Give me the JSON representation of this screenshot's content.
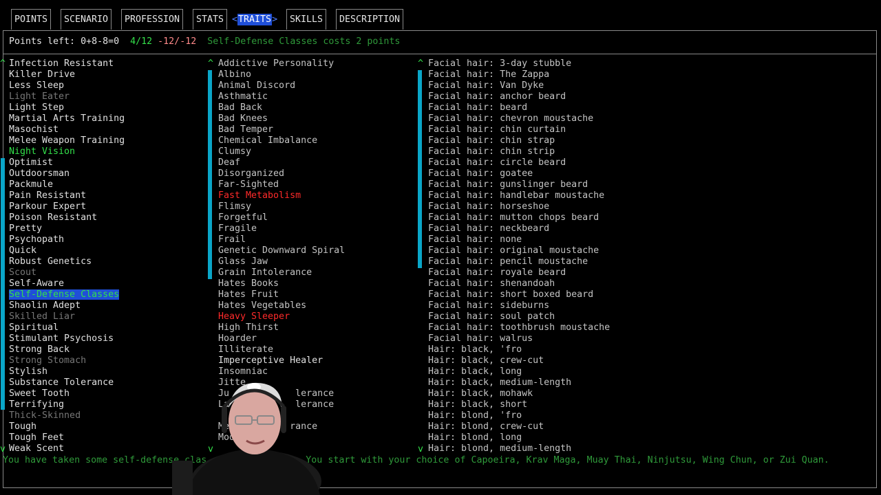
{
  "tabs": [
    {
      "label": "POINTS"
    },
    {
      "label": "SCENARIO"
    },
    {
      "label": "PROFESSION"
    },
    {
      "label": "STATS"
    },
    {
      "label": "TRAITS"
    },
    {
      "label": "SKILLS"
    },
    {
      "label": "DESCRIPTION"
    }
  ],
  "arrows": {
    "left": "<",
    "right": ">"
  },
  "status": {
    "points_left": "Points left: 0+8-8=0",
    "positive": "4/12",
    "negative": "-12/-12",
    "cost_msg": "Self-Defense Classes costs 2 points"
  },
  "scroll_glyphs": {
    "up": "^",
    "down": "v"
  },
  "col1": [
    {
      "t": "Infection Resistant",
      "s": "normal"
    },
    {
      "t": "Killer Drive",
      "s": "normal"
    },
    {
      "t": "Less Sleep",
      "s": "normal"
    },
    {
      "t": "Light Eater",
      "s": "dim"
    },
    {
      "t": "Light Step",
      "s": "normal"
    },
    {
      "t": "Martial Arts Training",
      "s": "normal"
    },
    {
      "t": "Masochist",
      "s": "normal"
    },
    {
      "t": "Melee Weapon Training",
      "s": "normal"
    },
    {
      "t": "Night Vision",
      "s": "green"
    },
    {
      "t": "Optimist",
      "s": "normal"
    },
    {
      "t": "Outdoorsman",
      "s": "normal"
    },
    {
      "t": "Packmule",
      "s": "normal"
    },
    {
      "t": "Pain Resistant",
      "s": "normal"
    },
    {
      "t": "Parkour Expert",
      "s": "normal"
    },
    {
      "t": "Poison Resistant",
      "s": "normal"
    },
    {
      "t": "Pretty",
      "s": "normal"
    },
    {
      "t": "Psychopath",
      "s": "normal"
    },
    {
      "t": "Quick",
      "s": "normal"
    },
    {
      "t": "Robust Genetics",
      "s": "normal"
    },
    {
      "t": "Scout",
      "s": "dim"
    },
    {
      "t": "Self-Aware",
      "s": "normal"
    },
    {
      "t": "Self-Defense Classes",
      "s": "sel"
    },
    {
      "t": "Shaolin Adept",
      "s": "normal"
    },
    {
      "t": "Skilled Liar",
      "s": "dim"
    },
    {
      "t": "Spiritual",
      "s": "normal"
    },
    {
      "t": "Stimulant Psychosis",
      "s": "normal"
    },
    {
      "t": "Strong Back",
      "s": "normal"
    },
    {
      "t": "Strong Stomach",
      "s": "dim"
    },
    {
      "t": "Stylish",
      "s": "normal"
    },
    {
      "t": "Substance Tolerance",
      "s": "normal"
    },
    {
      "t": "Sweet Tooth",
      "s": "normal"
    },
    {
      "t": "Terrifying",
      "s": "normal"
    },
    {
      "t": "Thick-Skinned",
      "s": "dim"
    },
    {
      "t": "Tough",
      "s": "normal"
    },
    {
      "t": "Tough Feet",
      "s": "normal"
    },
    {
      "t": "Weak Scent",
      "s": "normal"
    }
  ],
  "col2": [
    {
      "t": "Addictive Personality",
      "s": "gray"
    },
    {
      "t": "Albino",
      "s": "gray"
    },
    {
      "t": "Animal Discord",
      "s": "gray"
    },
    {
      "t": "Asthmatic",
      "s": "gray"
    },
    {
      "t": "Bad Back",
      "s": "gray"
    },
    {
      "t": "Bad Knees",
      "s": "gray"
    },
    {
      "t": "Bad Temper",
      "s": "gray"
    },
    {
      "t": "Chemical Imbalance",
      "s": "gray"
    },
    {
      "t": "Clumsy",
      "s": "gray"
    },
    {
      "t": "Deaf",
      "s": "gray"
    },
    {
      "t": "Disorganized",
      "s": "gray"
    },
    {
      "t": "Far-Sighted",
      "s": "gray"
    },
    {
      "t": "Fast Metabolism",
      "s": "red"
    },
    {
      "t": "Flimsy",
      "s": "gray"
    },
    {
      "t": "Forgetful",
      "s": "gray"
    },
    {
      "t": "Fragile",
      "s": "gray"
    },
    {
      "t": "Frail",
      "s": "gray"
    },
    {
      "t": "Genetic Downward Spiral",
      "s": "gray"
    },
    {
      "t": "Glass Jaw",
      "s": "gray"
    },
    {
      "t": "Grain Intolerance",
      "s": "gray"
    },
    {
      "t": "Hates Books",
      "s": "gray"
    },
    {
      "t": "Hates Fruit",
      "s": "gray"
    },
    {
      "t": "Hates Vegetables",
      "s": "gray"
    },
    {
      "t": "Heavy Sleeper",
      "s": "red"
    },
    {
      "t": "High Thirst",
      "s": "gray"
    },
    {
      "t": "Hoarder",
      "s": "gray"
    },
    {
      "t": "Illiterate",
      "s": "gray"
    },
    {
      "t": "Imperceptive Healer",
      "s": "normal"
    },
    {
      "t": "Insomniac",
      "s": "gray"
    },
    {
      "t": "Jitte",
      "s": "gray"
    },
    {
      "t": "Ju            lerance",
      "s": "gray"
    },
    {
      "t": "La            lerance",
      "s": "gray"
    },
    {
      "t": "",
      "s": "gray"
    },
    {
      "t": "Mea          rance",
      "s": "gray"
    },
    {
      "t": "Mod",
      "s": "gray"
    }
  ],
  "col3": [
    {
      "t": "Facial hair: 3-day stubble"
    },
    {
      "t": "Facial hair: The Zappa"
    },
    {
      "t": "Facial hair: Van Dyke"
    },
    {
      "t": "Facial hair: anchor beard"
    },
    {
      "t": "Facial hair: beard"
    },
    {
      "t": "Facial hair: chevron moustache"
    },
    {
      "t": "Facial hair: chin curtain"
    },
    {
      "t": "Facial hair: chin strap"
    },
    {
      "t": "Facial hair: chin strip"
    },
    {
      "t": "Facial hair: circle beard"
    },
    {
      "t": "Facial hair: goatee"
    },
    {
      "t": "Facial hair: gunslinger beard"
    },
    {
      "t": "Facial hair: handlebar moustache"
    },
    {
      "t": "Facial hair: horseshoe"
    },
    {
      "t": "Facial hair: mutton chops beard"
    },
    {
      "t": "Facial hair: neckbeard"
    },
    {
      "t": "Facial hair: none"
    },
    {
      "t": "Facial hair: original moustache"
    },
    {
      "t": "Facial hair: pencil moustache"
    },
    {
      "t": "Facial hair: royale beard"
    },
    {
      "t": "Facial hair: shenandoah"
    },
    {
      "t": "Facial hair: short boxed beard"
    },
    {
      "t": "Facial hair: sideburns"
    },
    {
      "t": "Facial hair: soul patch"
    },
    {
      "t": "Facial hair: toothbrush moustache"
    },
    {
      "t": "Facial hair: walrus"
    },
    {
      "t": "Hair: black, 'fro"
    },
    {
      "t": "Hair: black, crew-cut"
    },
    {
      "t": "Hair: black, long"
    },
    {
      "t": "Hair: black, medium-length"
    },
    {
      "t": "Hair: black, mohawk"
    },
    {
      "t": "Hair: black, short"
    },
    {
      "t": "Hair: blond, 'fro"
    },
    {
      "t": "Hair: blond, crew-cut"
    },
    {
      "t": "Hair: blond, long"
    },
    {
      "t": "Hair: blond, medium-length"
    }
  ],
  "description": "You have taken some self-defense clas            gym.  You start with your choice of Capoeira, Krav Maga, Muay Thai, Ninjutsu, Wing Chun, or Zui Quan."
}
